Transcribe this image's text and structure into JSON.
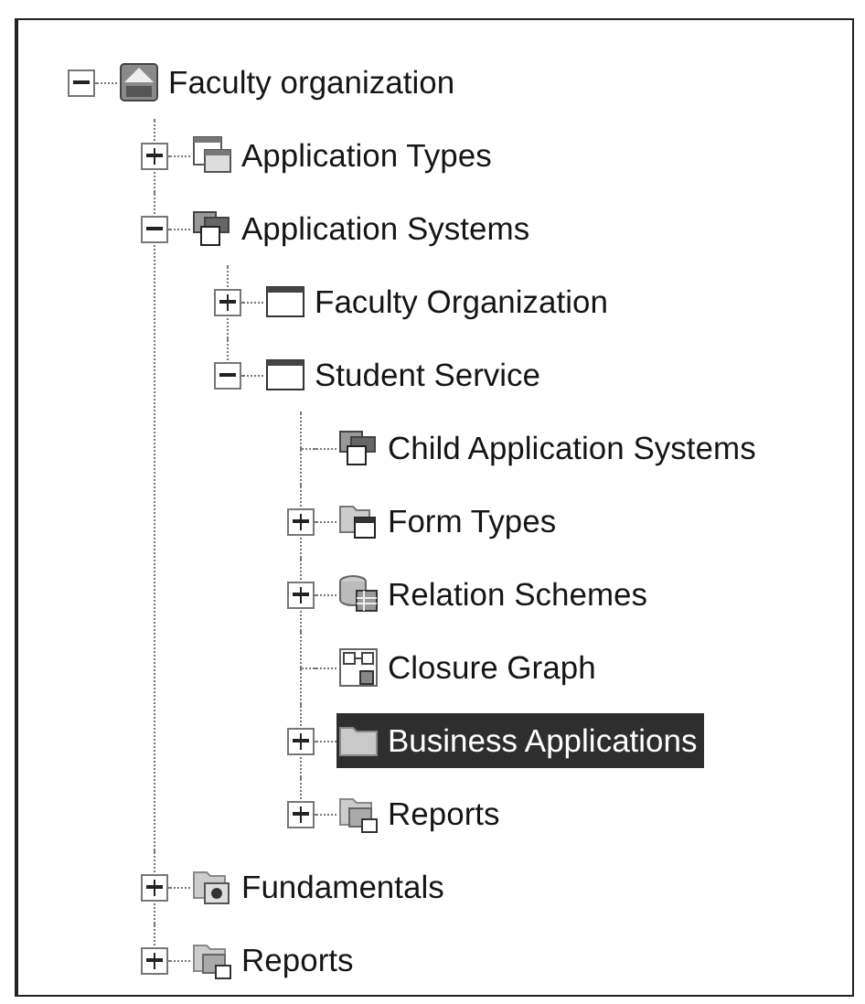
{
  "tree": [
    {
      "label": "Faculty organization",
      "kind": "root",
      "expanded": true,
      "selected": false,
      "children": [
        {
          "label": "Application Types",
          "kind": "types",
          "expanded": false,
          "selected": false
        },
        {
          "label": "Application Systems",
          "kind": "systems",
          "expanded": true,
          "selected": false,
          "children": [
            {
              "label": "Faculty Organization",
              "kind": "window",
              "expanded": false,
              "selected": false
            },
            {
              "label": "Student Service",
              "kind": "window",
              "expanded": true,
              "selected": false,
              "children": [
                {
                  "label": "Child Application Systems",
                  "kind": "systems",
                  "selected": false
                },
                {
                  "label": "Form Types",
                  "kind": "formtypes",
                  "expanded": false,
                  "selected": false
                },
                {
                  "label": "Relation Schemes",
                  "kind": "schemes",
                  "expanded": false,
                  "selected": false
                },
                {
                  "label": "Closure Graph",
                  "kind": "graph",
                  "selected": false
                },
                {
                  "label": "Business Applications",
                  "kind": "folder",
                  "expanded": false,
                  "selected": true
                },
                {
                  "label": "Reports",
                  "kind": "reports",
                  "expanded": false,
                  "selected": false
                }
              ]
            }
          ]
        },
        {
          "label": "Fundamentals",
          "kind": "fundamentals",
          "expanded": false,
          "selected": false
        },
        {
          "label": "Reports",
          "kind": "reports",
          "expanded": false,
          "selected": false
        }
      ]
    }
  ]
}
